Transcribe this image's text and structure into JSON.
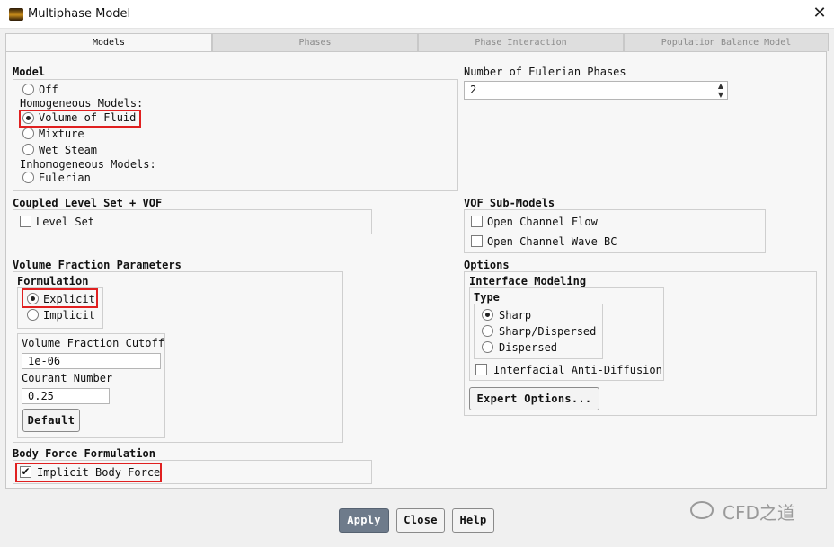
{
  "window": {
    "title": "Multiphase Model",
    "close": "✕"
  },
  "tabs": [
    {
      "label": "Models",
      "active": true
    },
    {
      "label": "Phases",
      "active": false
    },
    {
      "label": "Phase Interaction",
      "active": false
    },
    {
      "label": "Population Balance Model",
      "active": false
    }
  ],
  "model": {
    "header": "Model",
    "off": "Off",
    "homogeneous_label": "Homogeneous Models:",
    "vof": "Volume of Fluid",
    "mixture": "Mixture",
    "wet_steam": "Wet Steam",
    "inhomogeneous_label": "Inhomogeneous Models:",
    "eulerian": "Eulerian",
    "selected": "Volume of Fluid"
  },
  "phases": {
    "header": "Number of Eulerian Phases",
    "value": "2"
  },
  "coupled": {
    "header": "Coupled Level Set + VOF",
    "level_set": "Level Set",
    "level_set_checked": false
  },
  "vof_sub": {
    "header": "VOF Sub-Models",
    "open_channel_flow": "Open Channel Flow",
    "open_channel_wave": "Open Channel Wave BC",
    "flow_checked": false,
    "wave_checked": false
  },
  "vfp": {
    "header": "Volume Fraction Parameters",
    "formulation_header": "Formulation",
    "explicit": "Explicit",
    "implicit": "Implicit",
    "selected": "Explicit",
    "cutoff_label": "Volume Fraction Cutoff",
    "cutoff_value": "1e-06",
    "courant_label": "Courant Number",
    "courant_value": "0.25",
    "default_button": "Default"
  },
  "options": {
    "header": "Options",
    "interface_header": "Interface Modeling",
    "type_header": "Type",
    "sharp": "Sharp",
    "sharp_dispersed": "Sharp/Dispersed",
    "dispersed": "Dispersed",
    "selected": "Sharp",
    "anti_diffusion": "Interfacial Anti-Diffusion",
    "anti_diffusion_checked": false,
    "expert_button": "Expert Options..."
  },
  "body_force": {
    "header": "Body Force Formulation",
    "implicit": "Implicit Body Force",
    "checked": true
  },
  "footer": {
    "apply": "Apply",
    "close": "Close",
    "help": "Help"
  },
  "watermark": {
    "text": "CFD之道"
  },
  "colors": {
    "highlight": "#e02020",
    "apply_bg": "#6e7b8b"
  }
}
